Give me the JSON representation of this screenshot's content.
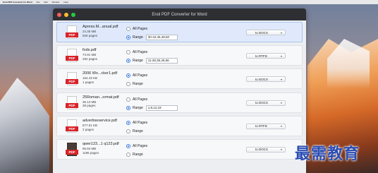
{
  "menubar": {
    "app": "Enol PDF Converter for Word",
    "items": [
      "File",
      "Edit",
      "Window",
      "Help"
    ]
  },
  "window": {
    "title": "Enol PDF Converter for Word"
  },
  "colors": {
    "pdf_tag": "#d8232a",
    "selected_row": "#dfe9fb",
    "titlebar": "#2d2f33"
  },
  "option_labels": {
    "all_pages": "All Pages",
    "range": "Range"
  },
  "icon_tag": "PDF",
  "files": [
    {
      "name": "Apress.M...anual.pdf",
      "size": "24.35 MB",
      "pages": "826 pages",
      "mode": "range",
      "range": "30-42,45,48,50",
      "format": "to DOCX",
      "selected": true
    },
    {
      "name": "fods.pdf",
      "size": "74.91 MB",
      "pages": "292 pages",
      "mode": "range",
      "range": "11-28,36,45,56",
      "format": "to RTFD",
      "selected": false
    },
    {
      "name": "2006 Wo...cker1.pdf",
      "size": "164.43 KB",
      "pages": "1 pages",
      "mode": "all",
      "range": "",
      "format": "to DOCX",
      "selected": false
    },
    {
      "name": "25Roman...ormat.pdf",
      "size": "36.13 MB",
      "pages": "38 pages",
      "mode": "range",
      "range": "1,8,12,19",
      "format": "to DOCX",
      "selected": false
    },
    {
      "name": "advertiseservice.pdf",
      "size": "577.61 KB",
      "pages": "2 pages",
      "mode": "all",
      "range": "",
      "format": "to RTFD",
      "selected": false
    },
    {
      "name": "qwer123...1 q123.pdf",
      "size": "95.94 MB",
      "pages": "1196 pages",
      "mode": "all",
      "range": "",
      "format": "to DOCX",
      "selected": false
    }
  ],
  "watermark": "最需教育"
}
